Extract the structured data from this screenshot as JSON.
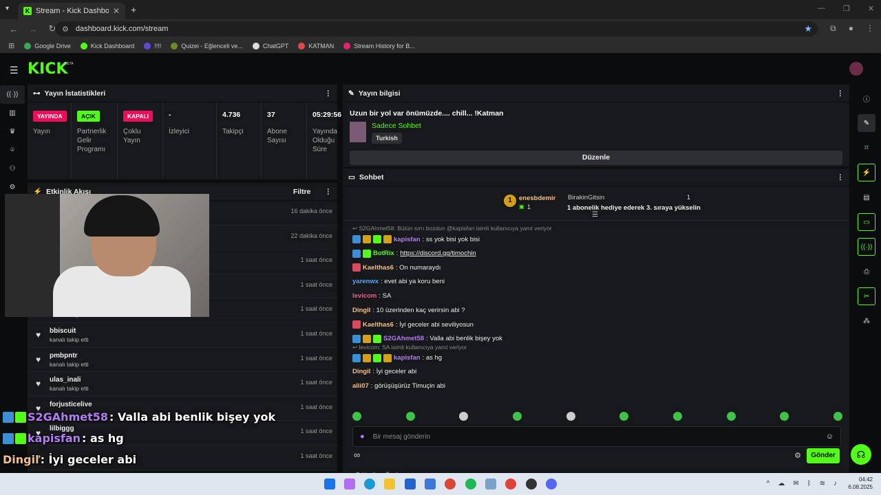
{
  "browser": {
    "tab_title": "Stream - Kick Dashboard",
    "url": "dashboard.kick.com/stream",
    "bookmarks": [
      {
        "label": "Google Drive",
        "color": "#34a853"
      },
      {
        "label": "Kick Dashboard",
        "color": "#53fc18"
      },
      {
        "label": "!!!!",
        "color": "#5b4bd6"
      },
      {
        "label": "Quizei - Eğlenceli ve...",
        "color": "#6b8e23"
      },
      {
        "label": "ChatGPT",
        "color": "#dddddd"
      },
      {
        "label": "KATMAN",
        "color": "#e24a4a"
      },
      {
        "label": "Stream History for B...",
        "color": "#e2246e"
      }
    ]
  },
  "brand": {
    "logo": "KICK",
    "beta": "BETA"
  },
  "stats_panel": {
    "title": "Yayın İstatistikleri",
    "items": [
      {
        "value": "YAYINDA",
        "label": "Yayın",
        "kind": "badge-red"
      },
      {
        "value": "AÇIK",
        "label": "Partnerlik Gelir Programı",
        "kind": "badge-green"
      },
      {
        "value": "KAPALI",
        "label": "Çoklu Yayın",
        "kind": "badge-red"
      },
      {
        "value": "-",
        "label": "İzleyici",
        "kind": "num"
      },
      {
        "value": "4.736",
        "label": "Takipçi",
        "kind": "num"
      },
      {
        "value": "37",
        "label": "Abone Sayısı",
        "kind": "num"
      },
      {
        "value": "05:29:56",
        "label": "Yayında Olduğu Süre",
        "kind": "num"
      }
    ]
  },
  "activity": {
    "title": "Etkinlik Akışı",
    "filter": "Filtre",
    "rows": [
      {
        "name": "",
        "sub": "",
        "time": "16 dakika önce"
      },
      {
        "name": "",
        "sub": "",
        "time": "22 dakika önce"
      },
      {
        "name": "",
        "sub": "",
        "time": "1 saat önce"
      },
      {
        "name": "",
        "sub": "",
        "time": "1 saat önce"
      },
      {
        "name": "",
        "sub": "kanalı takip etti",
        "time": "1 saat önce"
      },
      {
        "name": "bbiscuit",
        "sub": "kanalı takip etti",
        "time": "1 saat önce"
      },
      {
        "name": "pmbpntr",
        "sub": "kanalı takip etti",
        "time": "1 saat önce"
      },
      {
        "name": "ulas_inali",
        "sub": "kanalı takip etti",
        "time": "1 saat önce"
      },
      {
        "name": "forjusticelive",
        "sub": "",
        "time": "1 saat önce"
      },
      {
        "name": "lilbiggg",
        "sub": "",
        "time": "1 saat önce"
      },
      {
        "name": "",
        "sub": "",
        "time": "1 saat önce"
      }
    ]
  },
  "stream_info": {
    "title": "Yayın bilgisi",
    "stream_title": "Uzun bir yol var önümüzde.... chill... !Katman",
    "category": "Sadece Sohbet",
    "tag": "Turkish",
    "edit_label": "Düzenle"
  },
  "chat": {
    "title": "Sohbet",
    "pinned": {
      "gifter": "enesbdemir",
      "gifter_count": "1",
      "recipient": "BirakinGitsin",
      "recipient_count": "1",
      "message": "1 abonelik hediye ederek 3. sıraya yükselin"
    },
    "messages": [
      {
        "reply": "S2GAhmet58: Bütün sırrı bozdun @kapisfan isimli kullanıcıya yanıt veriyor",
        "user": "kapisfan",
        "color": "#b57cf5",
        "text": ": ss yok bisi yok bisi",
        "badges": [
          "#3a8fd6",
          "#d4a017",
          "#53fc18",
          "#d4a017"
        ]
      },
      {
        "user": "BotRix",
        "color": "#53fc18",
        "text": ": ",
        "link": "https://discord.gg/timochin",
        "badges": [
          "#3a8fd6",
          "#53fc18"
        ]
      },
      {
        "user": "Kaelthas6",
        "color": "#f5c087",
        "text": ": On numaraydı",
        "badges": [
          "#d94b5b"
        ]
      },
      {
        "user": "yarenwx",
        "color": "#5aa7f5",
        "text": ": evet abi ya koru beni",
        "badges": []
      },
      {
        "user": "levicom",
        "color": "#ef5a8a",
        "text": ": SA",
        "badges": []
      },
      {
        "user": "Dingil",
        "color": "#f5c087",
        "text": ": 10 üzerinden kaç verirsin abi ?",
        "badges": []
      },
      {
        "user": "Kaelthas6",
        "color": "#f5c087",
        "text": ": İyi geceler abi seviliyosun",
        "badges": [
          "#d94b5b"
        ]
      },
      {
        "user": "S2GAhmet58",
        "color": "#b57cf5",
        "text": ": Valla abi benlik bişey yok",
        "badges": [
          "#3a8fd6",
          "#d4a017",
          "#53fc18"
        ]
      },
      {
        "reply": "levicom: SA isimli kullanıcıya yanıt veriyor",
        "user": "kapisfan",
        "color": "#b57cf5",
        "text": ": as hg",
        "badges": [
          "#3a8fd6",
          "#d4a017",
          "#53fc18",
          "#d4a017"
        ]
      },
      {
        "user": "Dingil",
        "color": "#f5c087",
        "text": ": İyi geceler abi",
        "badges": []
      },
      {
        "user": "alii07",
        "color": "#f5c087",
        "text": ": görüşüşürüz Timuçin abi",
        "badges": []
      }
    ],
    "followers_only": "Takipçilere Özel",
    "input_placeholder": "Bir mesaj gönderin",
    "send_label": "Gönder"
  },
  "overlay": [
    {
      "user": "S2GAhmet58",
      "color": "#b57cf5",
      "text": " : Valla abi benlik bişey yok"
    },
    {
      "user": "kapisfan",
      "color": "#b57cf5",
      "text": " : as hg"
    },
    {
      "user": "Dingil",
      "color": "#f5c087",
      "text": " : İyi geceler abi"
    },
    {
      "user": "alii07",
      "color": "#f5c087",
      "text": " : görüşüşürüz Timuçin abi"
    }
  ],
  "taskbar": {
    "time": "04:42",
    "date": "6.08.2025"
  }
}
